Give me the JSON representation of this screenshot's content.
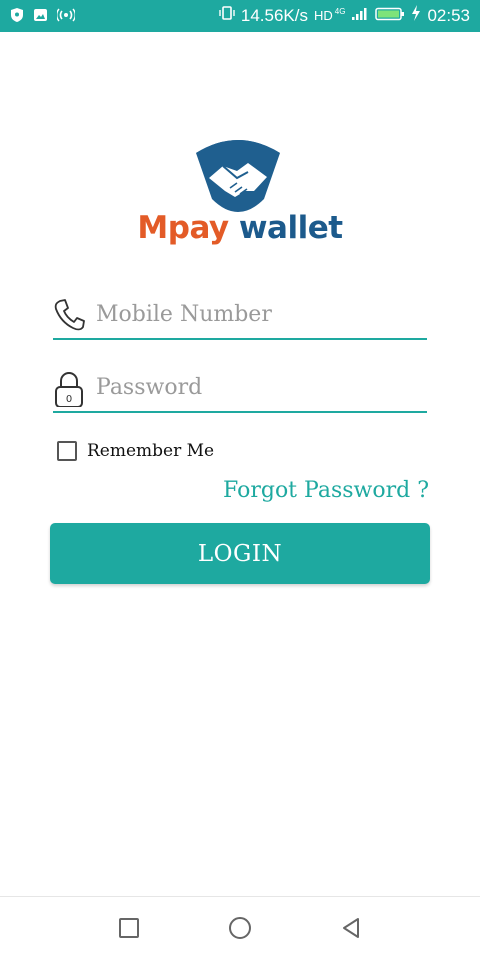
{
  "status_bar": {
    "net_speed": "14.56K/s",
    "hd_label": "HD",
    "network_type": "4G",
    "time": "02:53",
    "icons": [
      "shield-icon",
      "image-icon",
      "hotspot-icon",
      "vibrate-icon",
      "signal-icon",
      "battery-icon",
      "charging-icon"
    ]
  },
  "logo": {
    "brand_part1": "Mpay",
    "brand_part2": "wallet",
    "colors": {
      "orange": "#e35b27",
      "navy": "#1c5a8c"
    }
  },
  "form": {
    "mobile": {
      "placeholder": "Mobile Number",
      "icon": "phone-icon"
    },
    "password": {
      "placeholder": "Password",
      "icon": "lock-icon"
    },
    "remember_label": "Remember Me",
    "forgot_link": "Forgot Password ?",
    "login_button": "LOGIN"
  },
  "nav": {
    "icons": [
      "recent-apps-icon",
      "home-icon",
      "back-icon"
    ]
  },
  "theme": {
    "accent": "#1ea9a0"
  }
}
